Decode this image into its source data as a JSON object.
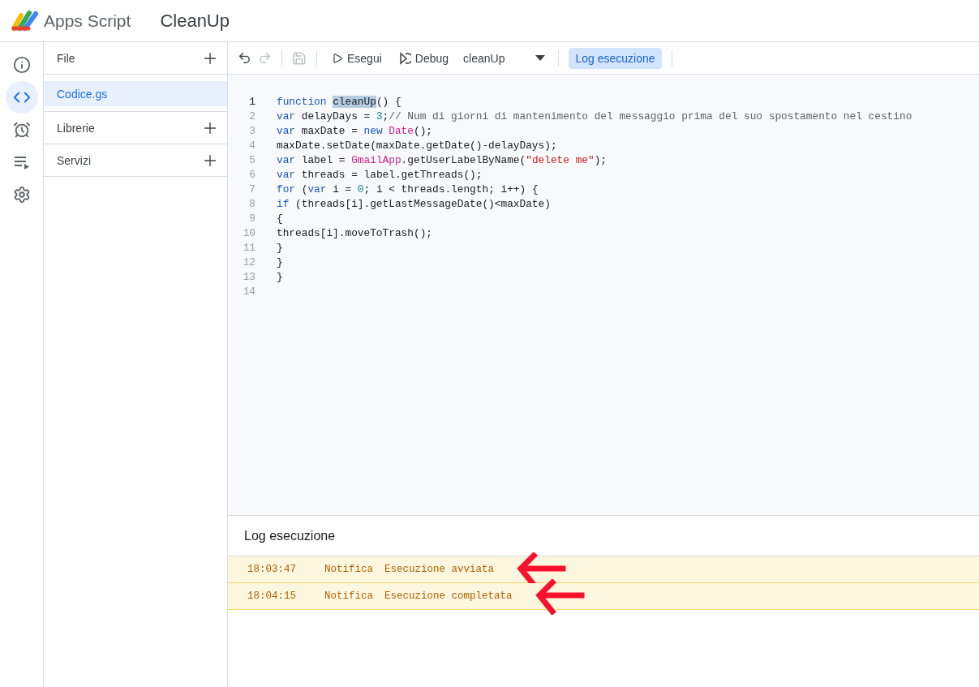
{
  "header": {
    "product": "Apps Script",
    "project": "CleanUp"
  },
  "rail": [
    {
      "kind": "info",
      "selected": false
    },
    {
      "kind": "editor",
      "selected": true
    },
    {
      "kind": "triggers",
      "selected": false
    },
    {
      "kind": "executions",
      "selected": false
    },
    {
      "kind": "settings",
      "selected": false
    }
  ],
  "files_panel": [
    {
      "title": "File",
      "files": [
        {
          "name": "Codice.gs",
          "selected": true
        }
      ]
    },
    {
      "title": "Librerie"
    },
    {
      "title": "Servizi"
    }
  ],
  "toolbar": [
    {
      "kind": "undo",
      "disabled": false
    },
    {
      "kind": "redo",
      "disabled": true
    },
    {
      "kind": "save",
      "disabled": true
    },
    {
      "kind": "run",
      "label": "Esegui"
    },
    {
      "kind": "debug",
      "label": "Debug"
    },
    {
      "kind": "function_select",
      "value": "cleanUp"
    },
    {
      "kind": "toggle",
      "label": "Log esecuzione",
      "selected": true
    }
  ],
  "code_lines": [
    {
      "number": "1",
      "current": true,
      "tokens": [
        {
          "kind": "keyword",
          "text": "function "
        },
        {
          "kind": "selection",
          "text": "cleanUp"
        },
        {
          "kind": "plain",
          "text": "() {"
        }
      ]
    },
    {
      "number": "2",
      "current": false,
      "tokens": [
        {
          "kind": "keyword",
          "text": "var"
        },
        {
          "kind": "plain",
          "text": " delayDays = "
        },
        {
          "kind": "number",
          "text": "3"
        },
        {
          "kind": "plain",
          "text": ";"
        },
        {
          "kind": "comment",
          "text": "// Num di giorni di mantenimento del messaggio prima del suo spostamento nel cestino"
        }
      ]
    },
    {
      "number": "3",
      "current": false,
      "tokens": [
        {
          "kind": "keyword",
          "text": "var"
        },
        {
          "kind": "plain",
          "text": " maxDate = "
        },
        {
          "kind": "keyword",
          "text": "new "
        },
        {
          "kind": "builtin",
          "text": "Date"
        },
        {
          "kind": "plain",
          "text": "();"
        }
      ]
    },
    {
      "number": "4",
      "current": false,
      "tokens": [
        {
          "kind": "plain",
          "text": "maxDate.setDate(maxDate.getDate()-delayDays);"
        }
      ]
    },
    {
      "number": "5",
      "current": false,
      "tokens": [
        {
          "kind": "keyword",
          "text": "var"
        },
        {
          "kind": "plain",
          "text": " label = "
        },
        {
          "kind": "builtin",
          "text": "GmailApp"
        },
        {
          "kind": "plain",
          "text": ".getUserLabelByName("
        },
        {
          "kind": "string",
          "text": "\"delete me\""
        },
        {
          "kind": "plain",
          "text": ");"
        }
      ]
    },
    {
      "number": "6",
      "current": false,
      "tokens": [
        {
          "kind": "keyword",
          "text": "var"
        },
        {
          "kind": "plain",
          "text": " threads = label.getThreads();"
        }
      ]
    },
    {
      "number": "7",
      "current": false,
      "tokens": [
        {
          "kind": "keyword",
          "text": "for"
        },
        {
          "kind": "plain",
          "text": " ("
        },
        {
          "kind": "keyword",
          "text": "var"
        },
        {
          "kind": "plain",
          "text": " i = "
        },
        {
          "kind": "number",
          "text": "0"
        },
        {
          "kind": "plain",
          "text": "; i < threads.length; i++) {"
        }
      ]
    },
    {
      "number": "8",
      "current": false,
      "tokens": [
        {
          "kind": "keyword",
          "text": "if"
        },
        {
          "kind": "plain",
          "text": " (threads[i].getLastMessageDate()<maxDate)"
        }
      ]
    },
    {
      "number": "9",
      "current": false,
      "tokens": [
        {
          "kind": "plain",
          "text": "{"
        }
      ]
    },
    {
      "number": "10",
      "current": false,
      "tokens": [
        {
          "kind": "plain",
          "text": "threads[i].moveToTrash();"
        }
      ]
    },
    {
      "number": "11",
      "current": false,
      "tokens": [
        {
          "kind": "plain",
          "text": "}"
        }
      ]
    },
    {
      "number": "12",
      "current": false,
      "tokens": [
        {
          "kind": "plain",
          "text": "}"
        }
      ]
    },
    {
      "number": "13",
      "current": false,
      "tokens": [
        {
          "kind": "plain",
          "text": "}"
        }
      ]
    },
    {
      "number": "14",
      "current": false
    }
  ],
  "log": {
    "title": "Log esecuzione",
    "entries": [
      {
        "time": "18:03:47",
        "level": "Notifica",
        "message": "Esecuzione avviata"
      },
      {
        "time": "18:04:15",
        "level": "Notifica",
        "message": "Esecuzione completata"
      }
    ]
  }
}
